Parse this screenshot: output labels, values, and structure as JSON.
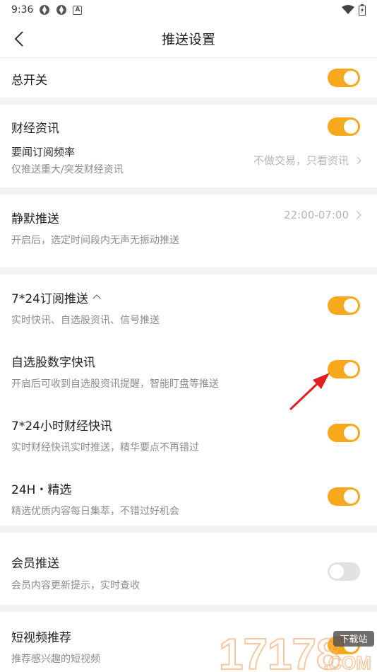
{
  "status": {
    "time": "9:36"
  },
  "header": {
    "title": "推送设置"
  },
  "master": {
    "title": "总开关",
    "on": true
  },
  "finance": {
    "title": "财经资讯",
    "on": true,
    "freq_title": "要闻订阅频率",
    "freq_sub": "仅推送重大/突发财经资讯",
    "freq_value": "不做交易，只看资讯"
  },
  "quiet": {
    "title": "静默推送",
    "sub": "开启后，选定时间段内无声无振动推送",
    "value": "22:00-07:00"
  },
  "subscribe": {
    "items": [
      {
        "title": "7*24订阅推送",
        "sub": "实时快讯、自选股资讯、信号推送",
        "on": true
      },
      {
        "title": "自选股数字快讯",
        "sub": "开启后可收到自选股资讯提醒，智能盯盘等推送",
        "on": true
      },
      {
        "title": "7*24小时财经快讯",
        "sub": "实时财经快讯实时推送，精华要点不再错过",
        "on": true
      },
      {
        "title": "24H・精选",
        "sub": "精选优质内容每日集萃，不错过好机会",
        "on": true
      }
    ]
  },
  "member": {
    "title": "会员推送",
    "sub": "会员内容更新提示，实时查收",
    "on": false
  },
  "video": {
    "title": "短视频推荐",
    "sub": "推荐感兴趣的短视频",
    "on": true
  },
  "watermark": {
    "digits": "17178",
    "domain": ".COM",
    "badge": "下载站"
  },
  "colors": {
    "accent": "#f8a81b",
    "annotation": "#e02020"
  }
}
